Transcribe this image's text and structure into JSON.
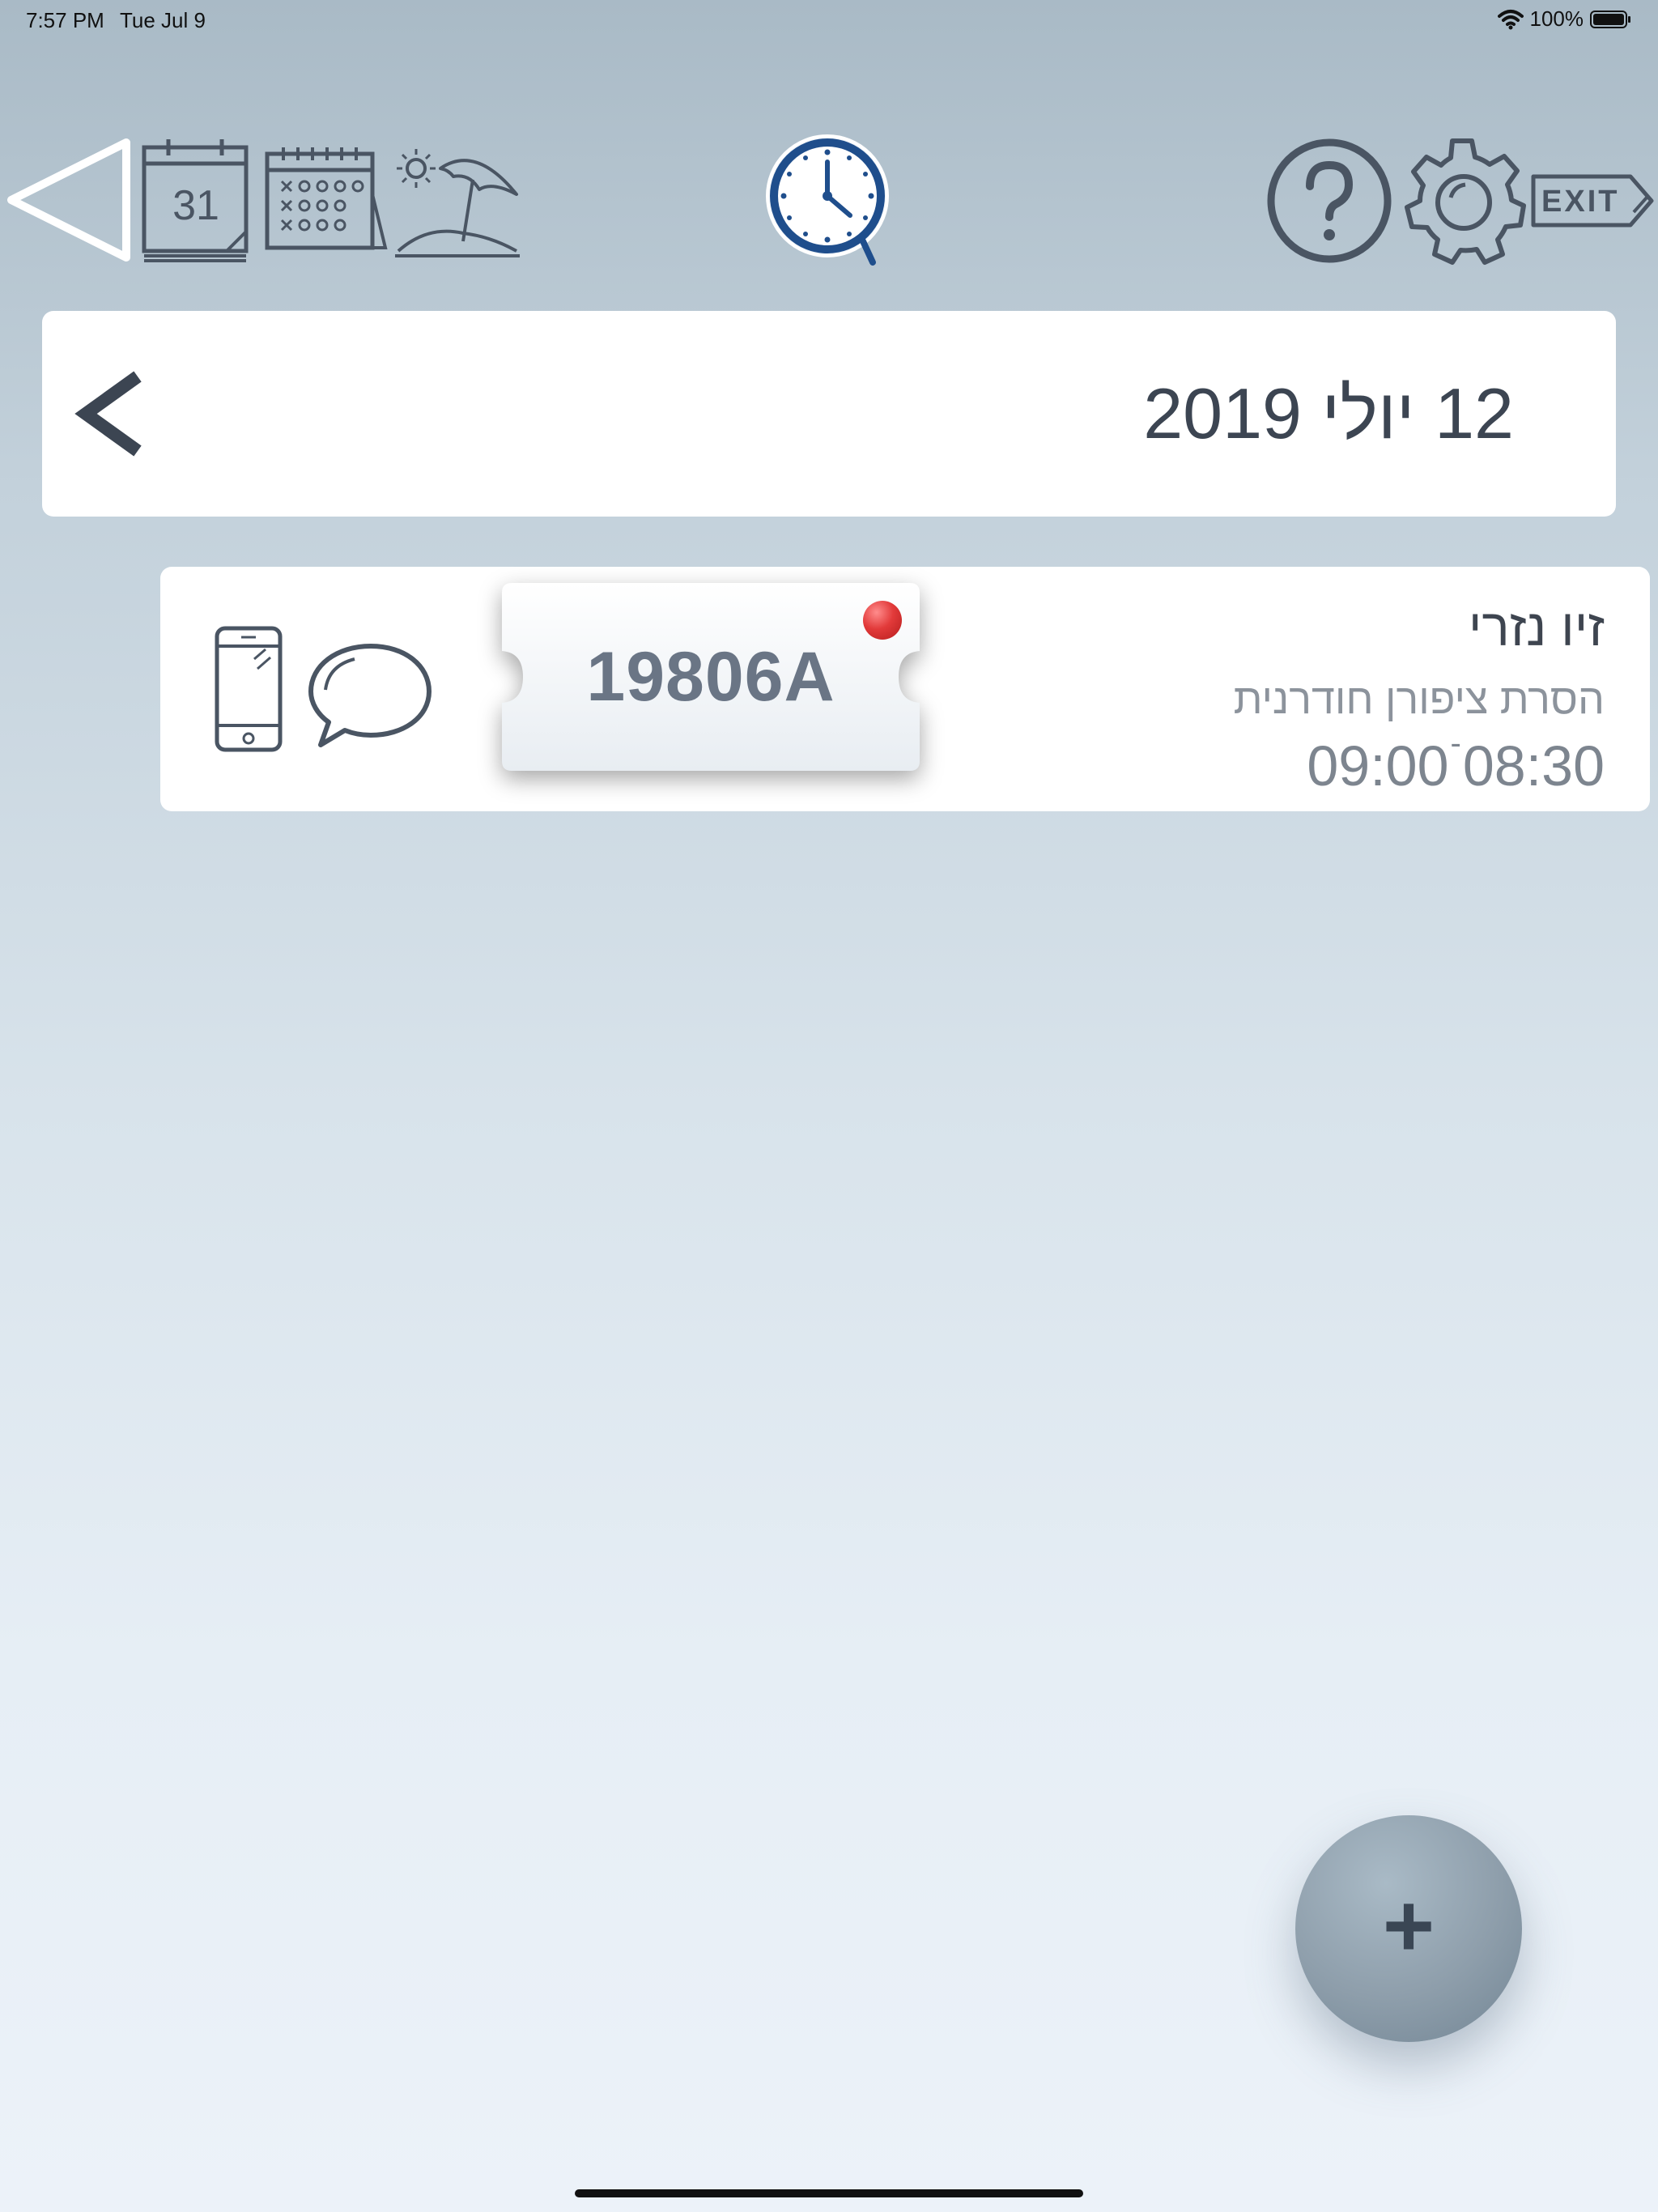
{
  "status_bar": {
    "time": "7:57 PM",
    "date": "Tue Jul 9",
    "battery": "100%"
  },
  "toolbar": {
    "calendar_day_number": "31",
    "exit_label": "EXIT",
    "icons": [
      "back-triangle-icon",
      "day-calendar-icon",
      "month-calendar-icon",
      "vacation-beach-icon",
      "clock-search-icon",
      "help-icon",
      "settings-gear-icon",
      "exit-icon"
    ]
  },
  "date_header": {
    "title": "12 יולי 2019"
  },
  "appointments": [
    {
      "name": "זיו נזרי",
      "service": "הסרת ציפורן חודרנית",
      "start": "08:30",
      "separator": "-",
      "end": "09:00",
      "ticket_code": "19806A",
      "status_color": "#e23a3a"
    }
  ],
  "fab": {
    "label": "+"
  },
  "colors": {
    "text_dark": "#3c4552",
    "icon_stroke": "#4a5563",
    "accent_clock": "#1f4e8c"
  }
}
